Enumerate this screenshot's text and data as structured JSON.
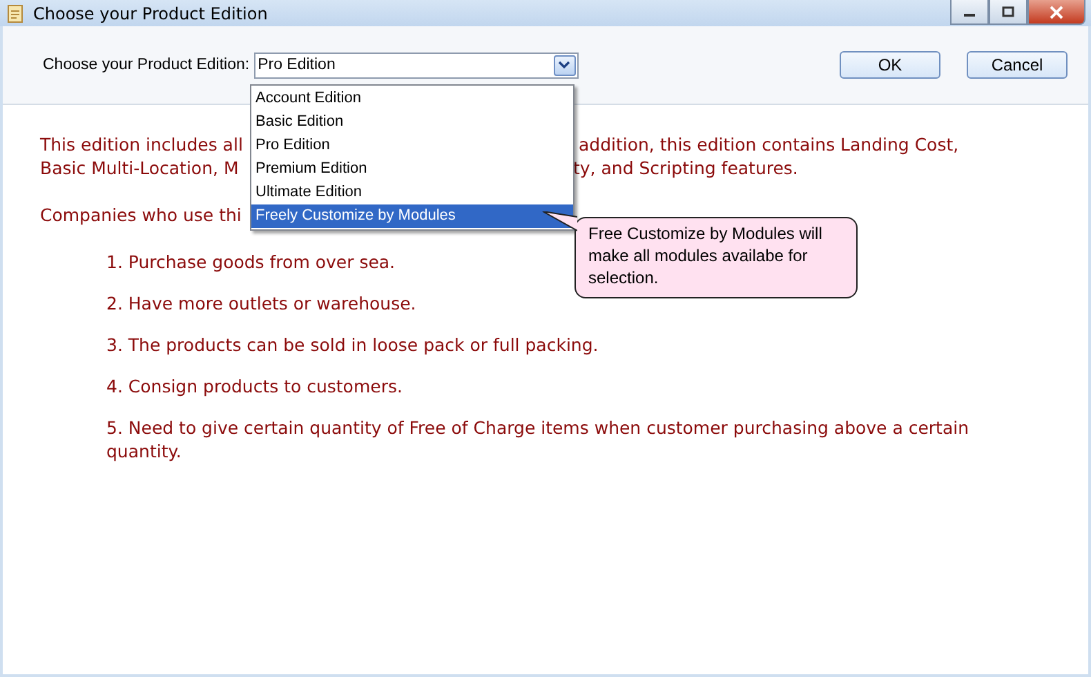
{
  "window": {
    "title": "Choose your Product Edition"
  },
  "edition_picker": {
    "label": "Choose your Product Edition:",
    "value": "Pro Edition",
    "expanded": true,
    "options": [
      {
        "label": "Account Edition",
        "highlighted": false
      },
      {
        "label": "Basic Edition",
        "highlighted": false
      },
      {
        "label": "Pro Edition",
        "highlighted": false
      },
      {
        "label": "Premium Edition",
        "highlighted": false
      },
      {
        "label": "Ultimate Edition",
        "highlighted": false
      },
      {
        "label": "Freely Customize by Modules",
        "highlighted": true
      }
    ]
  },
  "buttons": [
    {
      "label": "OK"
    },
    {
      "label": "Cancel"
    }
  ],
  "tooltip": {
    "text": "Free Customize by Modules will make all modules availabe for selection."
  },
  "description": {
    "paragraphs": [
      {
        "lines": [
          {
            "left": "This edition includes all",
            "right": " addition, this edition contains Landing Cost,"
          },
          {
            "left": "Basic Multi-Location, M",
            "right": "ty, and Scripting features."
          }
        ]
      },
      {
        "lines": [
          {
            "left": "Companies who use thi"
          }
        ]
      }
    ],
    "items": [
      "1. Purchase goods from over sea.",
      "2. Have more outlets or warehouse.",
      "3. The products can be sold in loose pack or full packing.",
      "4. Consign products to customers.",
      "5. Need to give certain quantity of Free of Charge items when customer purchasing above a certain quantity."
    ]
  }
}
